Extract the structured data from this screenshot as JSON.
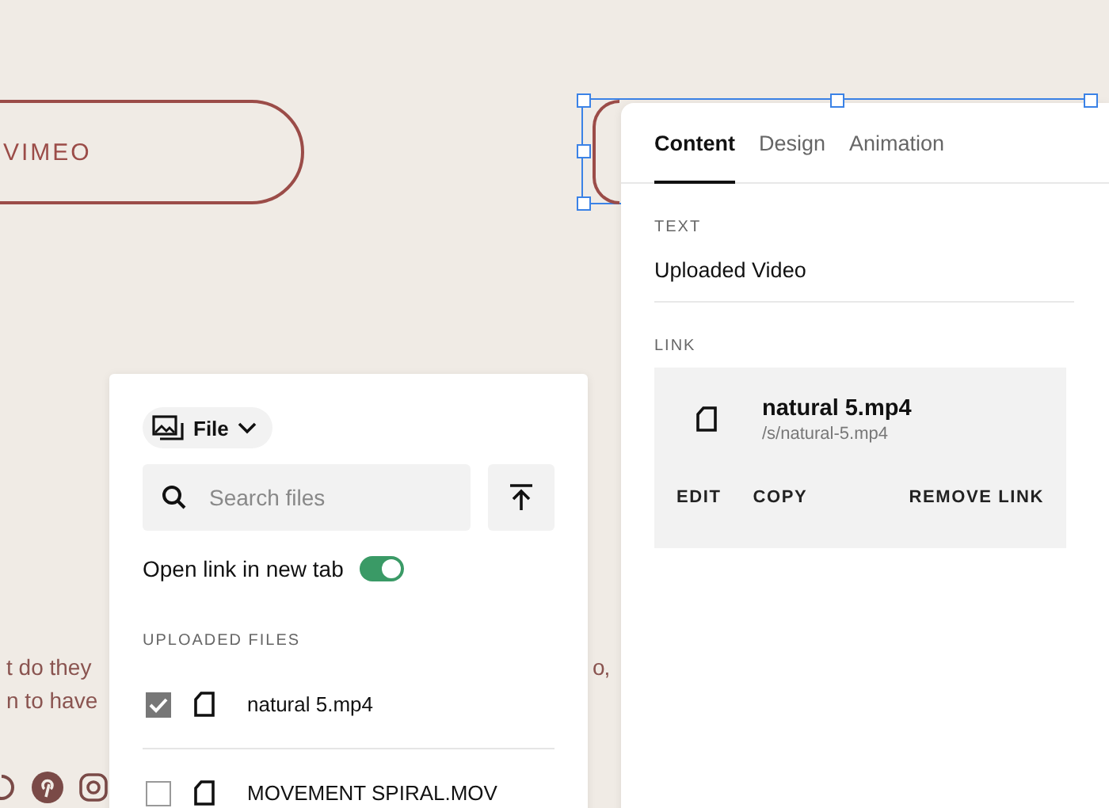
{
  "canvas": {
    "button_left": "VIMEO",
    "body_lines": [
      {
        "text": "t do they"
      },
      {
        "text": "n to have"
      }
    ],
    "body_right": "o,"
  },
  "file_picker": {
    "source": "File",
    "search": {
      "placeholder": "Search files"
    },
    "new_tab": {
      "label": "Open link in new tab",
      "on": true
    },
    "section": "UPLOADED FILES",
    "files": [
      {
        "name": "natural 5.mp4",
        "checked": true
      },
      {
        "name": "MOVEMENT SPIRAL.MOV",
        "checked": false
      }
    ]
  },
  "editor": {
    "tabs": [
      {
        "label": "Content",
        "selected": true
      },
      {
        "label": "Design",
        "selected": false
      },
      {
        "label": "Animation",
        "selected": false
      }
    ],
    "text_label": "TEXT",
    "text_value": "Uploaded Video",
    "link_label": "LINK",
    "link": {
      "name": "natural 5.mp4",
      "path": "/s/natural-5.mp4",
      "actions": [
        "EDIT",
        "COPY",
        "REMOVE LINK"
      ]
    }
  }
}
